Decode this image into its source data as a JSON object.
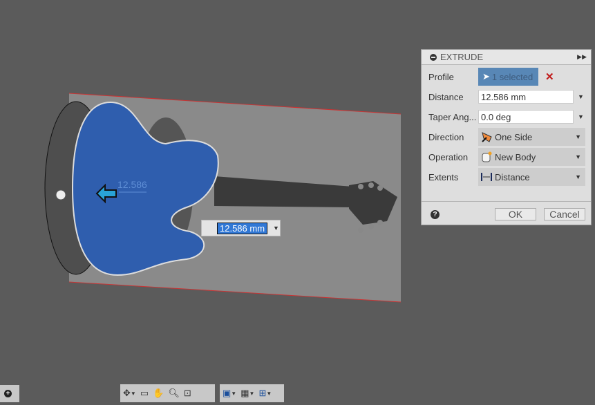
{
  "viewport": {
    "dimension_label": "12.586",
    "dimension_input": "12.586 mm",
    "body_color": "#2f5eae"
  },
  "extrude": {
    "title": "EXTRUDE",
    "profile": {
      "label": "Profile",
      "value": "1 selected"
    },
    "distance": {
      "label": "Distance",
      "value": "12.586 mm"
    },
    "taper": {
      "label": "Taper Ang...",
      "value": "0.0 deg"
    },
    "direction": {
      "label": "Direction",
      "value": "One Side",
      "icon": "one-side-icon"
    },
    "operation": {
      "label": "Operation",
      "value": "New Body",
      "icon": "new-body-icon"
    },
    "extents": {
      "label": "Extents",
      "value": "Distance",
      "icon": "distance-icon"
    },
    "ok": "OK",
    "cancel": "Cancel"
  },
  "toolbar": {
    "icons": [
      "orbit-icon",
      "look-at-icon",
      "pan-icon",
      "zoom-icon",
      "fit-icon",
      "display-settings-icon",
      "grid-icon",
      "viewports-icon"
    ]
  }
}
